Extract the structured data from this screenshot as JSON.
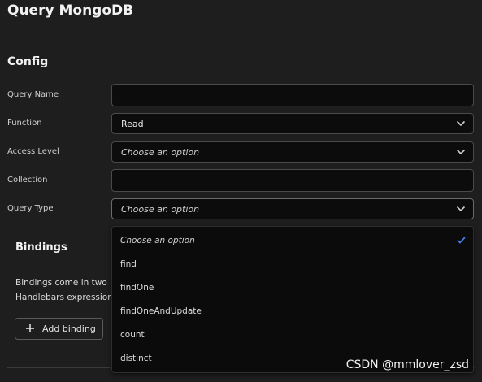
{
  "header": {
    "title": "Query MongoDB"
  },
  "config": {
    "title": "Config",
    "fields": [
      {
        "label": "Query Name",
        "value": ""
      },
      {
        "label": "Function",
        "value": "Read"
      },
      {
        "label": "Access Level",
        "placeholder": "Choose an option"
      },
      {
        "label": "Collection",
        "value": ""
      },
      {
        "label": "Query Type",
        "placeholder": "Choose an option"
      }
    ]
  },
  "query_type_menu": {
    "options": [
      {
        "label": "Choose an option",
        "selected": true
      },
      {
        "label": "find"
      },
      {
        "label": "findOne"
      },
      {
        "label": "findOneAndUpdate"
      },
      {
        "label": "count"
      },
      {
        "label": "distinct"
      }
    ]
  },
  "bindings": {
    "title": "Bindings",
    "description_line1": "Bindings come in two p",
    "description_line2": "Handlebars expression",
    "add_button_label": "Add binding"
  },
  "watermark": "CSDN @mmlover_zsd",
  "colors": {
    "background": "#1e1e1f",
    "input_background": "#0c0c0c",
    "accent_check": "#3d7fe0"
  },
  "icons": {
    "select": "chevron-down-icon",
    "selected": "checkmark-icon",
    "add": "plus-icon"
  }
}
